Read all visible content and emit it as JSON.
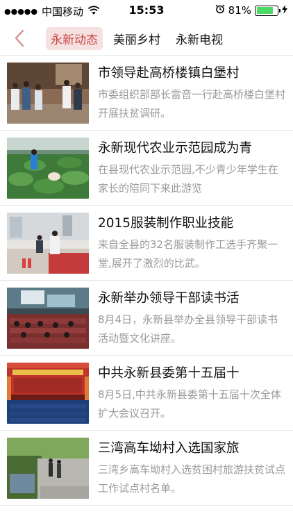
{
  "status_bar": {
    "carrier": "中国移动",
    "time": "15:53",
    "battery": "81%",
    "battery_level": 0.81
  },
  "nav": {
    "back_icon": "chevron-left-icon",
    "tabs": [
      {
        "label": "永新动态",
        "active": true
      },
      {
        "label": "美丽乡村",
        "active": false
      },
      {
        "label": "永新电视",
        "active": false
      }
    ]
  },
  "articles": [
    {
      "title": "市领导赴高桥楼镇白堡村",
      "summary": "市委组织部部长雷音一行赴高桥楼白堡村开展扶贫调研。"
    },
    {
      "title": "永新现代农业示范园成为青",
      "summary": "在县现代农业示范园,不少青少年学生在家长的陪同下来此游览"
    },
    {
      "title": "2015服装制作职业技能",
      "summary": "来自全县的32名服装制作工选手齐聚一堂,展开了激烈的比武。"
    },
    {
      "title": "永新举办领导干部读书活",
      "summary": "8月4日，永新县举办全县领导干部读书活动暨文化讲座。"
    },
    {
      "title": "中共永新县委第十五届十",
      "summary": "8月5日,中共永新县委第十五届十次全体扩大会议召开。"
    },
    {
      "title": "三湾高车坳村入选国家旅",
      "summary": "三湾乡高车坳村入选贫困村旅游扶贫试点工作试点村名单。"
    }
  ],
  "colors": {
    "accent": "#c8453f",
    "tab_active_bg": "#f6e1e1",
    "battery": "#4cd964",
    "summary_text": "#9a9a9a"
  }
}
